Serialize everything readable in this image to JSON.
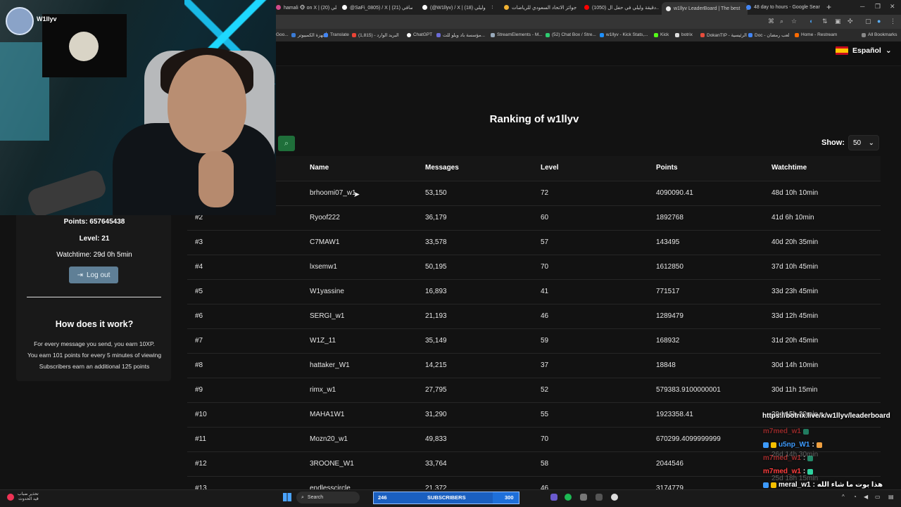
{
  "browser": {
    "tabs": [
      {
        "label": "hamali 🐵 on X | وليلي (20)",
        "color": "#d14a8b"
      },
      {
        "label": "@SaFi_0805) / X | صافي (21)",
        "color": "#ffffff"
      },
      {
        "label": "(@W1llyv) / X | وليلي (18)",
        "color": "#ffffff"
      },
      {
        "label": "جوائز الاتحاد السعودي للرياضات",
        "color": "#f2b233"
      },
      {
        "label": "(1050) دقيقة وليلي في حفل ال...",
        "color": "#ff0000"
      },
      {
        "label": "w1llyv LeaderBoard | The best",
        "color": "#eeeeee"
      },
      {
        "label": "48 day to hours - Google Sear",
        "color": "#4285f4"
      }
    ],
    "new_tab": "+",
    "bookmarks": [
      "Goo...",
      "أجهزة الكمبيوتر",
      "Translate",
      "البريد الوارد - (1,815)",
      "ChatGPT",
      "مؤسسة باد ويلو للت...",
      "StreamElements - M...",
      "(52) Chat Box / Stre...",
      "w1llyv - Kick Stats,...",
      "Kick",
      "botrix",
      "DokanTIP - الرئيسية",
      "Doc - لعب رمضان",
      "Home - Restream",
      "All Bookmarks"
    ]
  },
  "header": {
    "language": "Español",
    "title": "Ranking of w1llyv",
    "show_label": "Show:",
    "show_value": "50"
  },
  "table": {
    "columns": {
      "rank": "",
      "name": "Name",
      "messages": "Messages",
      "level": "Level",
      "points": "Points",
      "watchtime": "Watchtime"
    },
    "rows": [
      {
        "rank": "",
        "name": "brhoomi07_w1",
        "messages": "53,150",
        "level": "72",
        "points": "4090090.41",
        "watchtime": "48d 10h 10min"
      },
      {
        "rank": "#2",
        "name": "Ryoof222",
        "messages": "36,179",
        "level": "60",
        "points": "1892768",
        "watchtime": "41d 6h 10min"
      },
      {
        "rank": "#3",
        "name": "C7MAW1",
        "messages": "33,578",
        "level": "57",
        "points": "143495",
        "watchtime": "40d 20h 35min"
      },
      {
        "rank": "#4",
        "name": "lxsemw1",
        "messages": "50,195",
        "level": "70",
        "points": "1612850",
        "watchtime": "37d 10h 45min"
      },
      {
        "rank": "#5",
        "name": "W1yassine",
        "messages": "16,893",
        "level": "41",
        "points": "771517",
        "watchtime": "33d 23h 45min"
      },
      {
        "rank": "#6",
        "name": "SERGI_w1",
        "messages": "21,193",
        "level": "46",
        "points": "1289479",
        "watchtime": "33d 12h 45min"
      },
      {
        "rank": "#7",
        "name": "W1Z_11",
        "messages": "35,149",
        "level": "59",
        "points": "168932",
        "watchtime": "31d 20h 45min"
      },
      {
        "rank": "#8",
        "name": "hattaker_W1",
        "messages": "14,215",
        "level": "37",
        "points": "18848",
        "watchtime": "30d 14h 10min"
      },
      {
        "rank": "#9",
        "name": "rimx_w1",
        "messages": "27,795",
        "level": "52",
        "points": "579383.9100000001",
        "watchtime": "30d 11h 15min"
      },
      {
        "rank": "#10",
        "name": "MAHA1W1",
        "messages": "31,290",
        "level": "55",
        "points": "1923358.41",
        "watchtime": "29d 15h 20min"
      },
      {
        "rank": "#11",
        "name": "Mozn20_w1",
        "messages": "49,833",
        "level": "70",
        "points": "670299.4099999999",
        "watchtime": ""
      },
      {
        "rank": "#12",
        "name": "3ROONE_W1",
        "messages": "33,764",
        "level": "58",
        "points": "2044546",
        "watchtime": ""
      },
      {
        "rank": "#13",
        "name": "endlesscircle",
        "messages": "21,372",
        "level": "46",
        "points": "3174779",
        "watchtime": ""
      }
    ]
  },
  "sidebar": {
    "points": "Points: 657645438",
    "level": "Level: 21",
    "watchtime": "Watchtime: 29d 0h 5min",
    "logout": "Log out",
    "how_title": "How does it work?",
    "how_lines": [
      "For every message you send, you earn 10XP.",
      "You earn 101 points for every 5 minutes of viewing",
      "Subscribers earn an additional 125 points"
    ]
  },
  "webcam": {
    "streamer_name": "W1llyv"
  },
  "chat": {
    "url": "https://botrix.live/k/w1llyv/leaderboard",
    "messages": [
      {
        "user": "m7med_w1",
        "text": "",
        "color": "#ff3b3b"
      },
      {
        "user": "u5np_W1",
        "text": ":",
        "color": "#3d9bff"
      },
      {
        "user": "m7med_w1",
        "text": ":",
        "color": "#ff3b3b"
      },
      {
        "user": "meral_w1",
        "text": ": هذا بوت ما شاء الله",
        "color": "#ffffff"
      },
      {
        "user": "m7med_w1",
        "text": ":",
        "color": "#ff3b3b"
      }
    ],
    "overlap_watchtimes": [
      "26d 14h 30min",
      "25d 18h 15min"
    ]
  },
  "taskbar": {
    "weather": [
      "تحذير ضباب",
      "قيد الحدوث"
    ],
    "search": "Search",
    "subs_current": "246",
    "subs_label": "SUBSCRIBERS",
    "subs_goal": "300",
    "subs_progress": 0.82
  }
}
